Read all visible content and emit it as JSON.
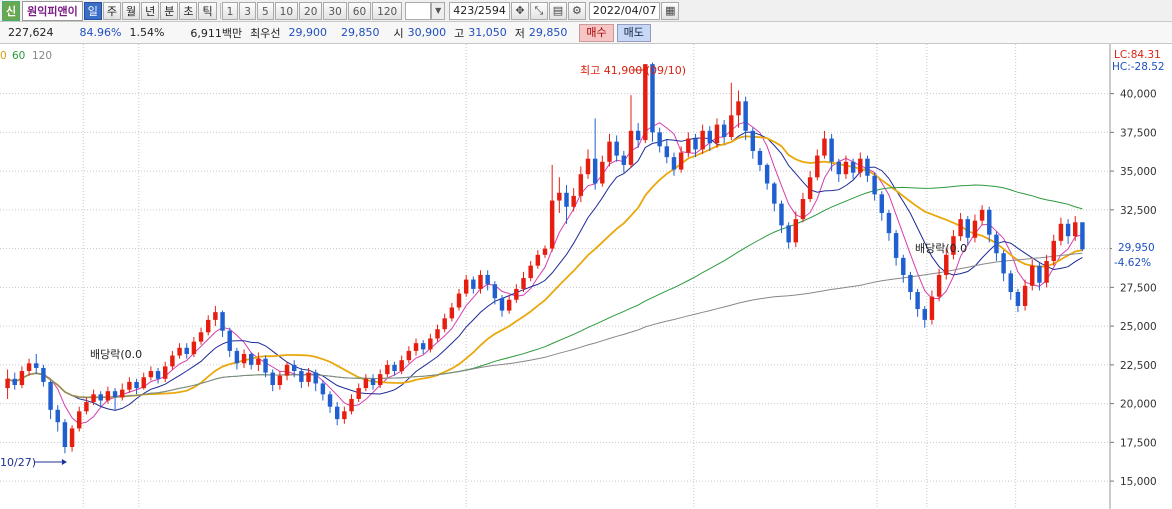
{
  "toolbar": {
    "badge": "신",
    "stock_name": "원익피앤이",
    "periods": [
      "일",
      "주",
      "월",
      "년",
      "분",
      "초",
      "틱"
    ],
    "selected_period": "일",
    "intervals": [
      "1",
      "3",
      "5",
      "10",
      "20",
      "30",
      "60",
      "120"
    ],
    "count": "423",
    "total": "/2594",
    "date": "2022/04/07"
  },
  "quote": {
    "volume": "227,624",
    "vol_ratio": "84.96%",
    "turnover": "1.54%",
    "amount": "6,911백만",
    "best_label": "최우선",
    "best_ask": "29,900",
    "best_bid": "29,850",
    "open_label": "시",
    "open": "30,900",
    "high_label": "고",
    "high": "31,050",
    "low_label": "저",
    "low": "29,850",
    "buy": "매수",
    "sell": "매도"
  },
  "ma_legend": {
    "first": "0",
    "second": "60",
    "third": "120"
  },
  "right_info": {
    "lc": "LC:84.31",
    "hc": "HC:-28.52",
    "price": "29,950",
    "change": "-4.62%"
  },
  "annotations": {
    "high": "최고 41,900 (09/10)",
    "low": "10/27)",
    "dividend1": "배당락(0.0",
    "dividend2": "배당락(0.0"
  },
  "chart_data": {
    "type": "candlestick",
    "y_ticks": [
      15000,
      17500,
      20000,
      22500,
      25000,
      27500,
      30000,
      32500,
      35000,
      37500,
      40000
    ],
    "y_tick_labels": [
      "15,000",
      "17,500",
      "20,000",
      "22,500",
      "25,000",
      "27,500",
      "30,000",
      "32,500",
      "35,000",
      "37,500",
      "40,000"
    ],
    "ylim": [
      13200,
      43200
    ],
    "x_vlines": [
      0.075,
      0.125,
      0.42,
      0.625,
      0.79,
      0.835,
      0.915
    ],
    "candles": [
      [
        0,
        21000,
        21600,
        20300,
        22200
      ],
      [
        1,
        21600,
        21200,
        20900,
        22000
      ],
      [
        2,
        21200,
        22100,
        21000,
        22400
      ],
      [
        3,
        22100,
        22600,
        21800,
        22900
      ],
      [
        4,
        22600,
        22300,
        21900,
        23200
      ],
      [
        5,
        22300,
        21400,
        21100,
        22500
      ],
      [
        6,
        21400,
        19600,
        19000,
        21500
      ],
      [
        7,
        19600,
        18800,
        18200,
        19900
      ],
      [
        8,
        18800,
        17200,
        16800,
        19000
      ],
      [
        9,
        17200,
        18400,
        16900,
        18600
      ],
      [
        10,
        18400,
        19500,
        18200,
        19800
      ],
      [
        11,
        19500,
        20100,
        19300,
        20400
      ],
      [
        12,
        20100,
        20600,
        19900,
        20900
      ],
      [
        13,
        20600,
        20200,
        19800,
        20800
      ],
      [
        14,
        20200,
        20800,
        20000,
        21100
      ],
      [
        15,
        20800,
        20400,
        19600,
        21000
      ],
      [
        16,
        20400,
        20900,
        20200,
        21300
      ],
      [
        17,
        20900,
        21400,
        20700,
        21700
      ],
      [
        18,
        21400,
        21000,
        20600,
        21600
      ],
      [
        19,
        21000,
        21700,
        20900,
        22000
      ],
      [
        20,
        21700,
        22100,
        21500,
        22400
      ],
      [
        21,
        22100,
        21600,
        21300,
        22300
      ],
      [
        22,
        21600,
        22400,
        21400,
        22700
      ],
      [
        23,
        22400,
        23100,
        22200,
        23400
      ],
      [
        24,
        23100,
        23600,
        22900,
        23900
      ],
      [
        25,
        23600,
        23200,
        22900,
        23900
      ],
      [
        26,
        23200,
        24000,
        23000,
        24300
      ],
      [
        27,
        24000,
        24600,
        23800,
        24900
      ],
      [
        28,
        24600,
        25400,
        24400,
        25700
      ],
      [
        29,
        25400,
        25900,
        25000,
        26300
      ],
      [
        30,
        25900,
        24700,
        24300,
        26000
      ],
      [
        31,
        24700,
        23400,
        23000,
        24900
      ],
      [
        32,
        23400,
        22600,
        22200,
        23600
      ],
      [
        33,
        22600,
        23200,
        22300,
        23500
      ],
      [
        34,
        23200,
        22500,
        22200,
        23300
      ],
      [
        35,
        22500,
        22900,
        22100,
        23300
      ],
      [
        36,
        22900,
        22000,
        21700,
        23100
      ],
      [
        37,
        22000,
        21200,
        20800,
        22200
      ],
      [
        38,
        21200,
        21800,
        20900,
        22100
      ],
      [
        39,
        21800,
        22500,
        21500,
        22700
      ],
      [
        40,
        22500,
        22100,
        21700,
        22800
      ],
      [
        41,
        22100,
        21400,
        21000,
        22300
      ],
      [
        42,
        21400,
        22000,
        21100,
        22300
      ],
      [
        43,
        22000,
        21300,
        20800,
        22200
      ],
      [
        44,
        21300,
        20600,
        20200,
        21500
      ],
      [
        45,
        20600,
        19800,
        19400,
        20800
      ],
      [
        46,
        19800,
        19000,
        18600,
        20100
      ],
      [
        47,
        19000,
        19500,
        18700,
        19800
      ],
      [
        48,
        19500,
        20300,
        19300,
        20600
      ],
      [
        49,
        20300,
        21000,
        20100,
        21300
      ],
      [
        50,
        21000,
        21600,
        20800,
        21900
      ],
      [
        51,
        21600,
        21200,
        20900,
        21900
      ],
      [
        52,
        21200,
        21900,
        21000,
        22200
      ],
      [
        53,
        21900,
        22500,
        21700,
        22800
      ],
      [
        54,
        22500,
        22100,
        21800,
        22700
      ],
      [
        55,
        22100,
        22800,
        21900,
        23100
      ],
      [
        56,
        22800,
        23400,
        22600,
        23700
      ],
      [
        57,
        23400,
        23900,
        23100,
        24200
      ],
      [
        58,
        23900,
        23500,
        23200,
        24100
      ],
      [
        59,
        23500,
        24200,
        23300,
        24500
      ],
      [
        60,
        24200,
        24800,
        24000,
        25100
      ],
      [
        61,
        24800,
        25500,
        24600,
        25800
      ],
      [
        62,
        25500,
        26200,
        25300,
        26500
      ],
      [
        63,
        26200,
        27100,
        26000,
        27400
      ],
      [
        64,
        27100,
        28000,
        26900,
        28300
      ],
      [
        65,
        28000,
        27400,
        27100,
        28200
      ],
      [
        66,
        27400,
        28300,
        27100,
        28600
      ],
      [
        67,
        28300,
        27700,
        27300,
        28600
      ],
      [
        68,
        27700,
        26800,
        26400,
        27900
      ],
      [
        69,
        26800,
        26000,
        25600,
        27000
      ],
      [
        70,
        26000,
        26700,
        25800,
        27000
      ],
      [
        71,
        26700,
        27400,
        26500,
        27700
      ],
      [
        72,
        27400,
        28100,
        27200,
        28500
      ],
      [
        73,
        28100,
        28900,
        27900,
        29200
      ],
      [
        74,
        28900,
        29600,
        28700,
        29900
      ],
      [
        75,
        29600,
        30000,
        29400,
        30200
      ],
      [
        76,
        30000,
        33100,
        29800,
        35400
      ],
      [
        77,
        33100,
        33600,
        32300,
        34600
      ],
      [
        78,
        33600,
        32700,
        31600,
        34100
      ],
      [
        79,
        32700,
        33400,
        32400,
        33900
      ],
      [
        80,
        33400,
        34800,
        33000,
        35300
      ],
      [
        81,
        34800,
        35800,
        34500,
        36400
      ],
      [
        82,
        35800,
        34200,
        33800,
        38400
      ],
      [
        83,
        34200,
        35600,
        34000,
        36000
      ],
      [
        84,
        35600,
        36900,
        35300,
        37400
      ],
      [
        85,
        36900,
        36000,
        35600,
        37300
      ],
      [
        86,
        36000,
        35400,
        34900,
        36300
      ],
      [
        87,
        35400,
        37600,
        35200,
        39900
      ],
      [
        88,
        37600,
        37000,
        36500,
        38100
      ],
      [
        89,
        37000,
        41900,
        36800,
        41900
      ],
      [
        90,
        41900,
        37500,
        36900,
        42000
      ],
      [
        91,
        37500,
        36600,
        36200,
        37800
      ],
      [
        92,
        36600,
        35900,
        35500,
        37000
      ],
      [
        93,
        35900,
        35100,
        34700,
        36200
      ],
      [
        94,
        35100,
        36200,
        34900,
        36600
      ],
      [
        95,
        36200,
        37100,
        35900,
        37500
      ],
      [
        96,
        37100,
        36400,
        35900,
        37400
      ],
      [
        97,
        36400,
        37600,
        36100,
        38000
      ],
      [
        98,
        37600,
        36800,
        36300,
        37900
      ],
      [
        99,
        36800,
        38000,
        36500,
        38400
      ],
      [
        100,
        38000,
        37200,
        36800,
        38300
      ],
      [
        101,
        37200,
        38600,
        37000,
        40700
      ],
      [
        102,
        38600,
        39500,
        37800,
        40200
      ],
      [
        103,
        39500,
        37600,
        37000,
        39800
      ],
      [
        104,
        37600,
        36300,
        35800,
        37800
      ],
      [
        105,
        36300,
        35400,
        35000,
        36500
      ],
      [
        106,
        35400,
        34200,
        33800,
        35500
      ],
      [
        107,
        34200,
        32900,
        32400,
        34300
      ],
      [
        108,
        32900,
        31500,
        31000,
        33100
      ],
      [
        109,
        31500,
        30400,
        30000,
        31700
      ],
      [
        110,
        30400,
        31900,
        30100,
        32400
      ],
      [
        111,
        31900,
        33200,
        31700,
        33600
      ],
      [
        112,
        33200,
        34600,
        33000,
        35000
      ],
      [
        113,
        34600,
        36000,
        34400,
        36400
      ],
      [
        114,
        36000,
        37100,
        35800,
        37600
      ],
      [
        115,
        37100,
        35600,
        35000,
        37400
      ],
      [
        116,
        35600,
        34800,
        34300,
        35800
      ],
      [
        117,
        34800,
        35600,
        34500,
        36000
      ],
      [
        118,
        35600,
        34900,
        34500,
        35800
      ],
      [
        119,
        34900,
        35800,
        34600,
        36200
      ],
      [
        120,
        35800,
        34700,
        34300,
        36000
      ],
      [
        121,
        34700,
        33500,
        33100,
        34900
      ],
      [
        122,
        33500,
        32300,
        31800,
        33700
      ],
      [
        123,
        32300,
        31000,
        30500,
        32500
      ],
      [
        124,
        31000,
        29400,
        28900,
        31200
      ],
      [
        125,
        29400,
        28300,
        27800,
        29600
      ],
      [
        126,
        28300,
        27200,
        26700,
        28500
      ],
      [
        127,
        27200,
        26100,
        25600,
        27400
      ],
      [
        128,
        26100,
        25400,
        24900,
        26300
      ],
      [
        129,
        25400,
        26900,
        25100,
        27300
      ],
      [
        130,
        26900,
        28300,
        26600,
        28700
      ],
      [
        131,
        28300,
        29600,
        28000,
        30000
      ],
      [
        132,
        29600,
        30800,
        29300,
        31200
      ],
      [
        133,
        30800,
        31900,
        30500,
        32300
      ],
      [
        134,
        31900,
        30700,
        30200,
        32100
      ],
      [
        135,
        30700,
        31800,
        30400,
        32200
      ],
      [
        136,
        31800,
        32500,
        31500,
        32800
      ],
      [
        137,
        32500,
        30900,
        30400,
        32700
      ],
      [
        138,
        30900,
        29700,
        29200,
        31100
      ],
      [
        139,
        29700,
        28400,
        27900,
        29900
      ],
      [
        140,
        28400,
        27200,
        26700,
        28600
      ],
      [
        141,
        27200,
        26300,
        25900,
        27400
      ],
      [
        142,
        26300,
        27600,
        26000,
        28000
      ],
      [
        143,
        27600,
        28900,
        27300,
        29300
      ],
      [
        144,
        28900,
        27800,
        27300,
        29100
      ],
      [
        145,
        27800,
        29200,
        27500,
        29600
      ],
      [
        146,
        29200,
        30500,
        28900,
        30900
      ],
      [
        147,
        30500,
        31600,
        30200,
        32000
      ],
      [
        148,
        31600,
        30800,
        30300,
        31900
      ],
      [
        149,
        30800,
        31700,
        30500,
        32100
      ],
      [
        150,
        31700,
        29950,
        29850,
        31050
      ]
    ],
    "candle_count": 151,
    "ma_series": [
      {
        "color": "#d43fb0",
        "window": 5
      },
      {
        "color": "#1d2a96",
        "window": 10
      },
      {
        "color": "#e9a80c",
        "window": 20
      },
      {
        "color": "#2a9a3a",
        "window": 60
      },
      {
        "color": "#888888",
        "window": 120
      }
    ],
    "up_color": "#e61e10",
    "down_color": "#1f5fd0"
  }
}
